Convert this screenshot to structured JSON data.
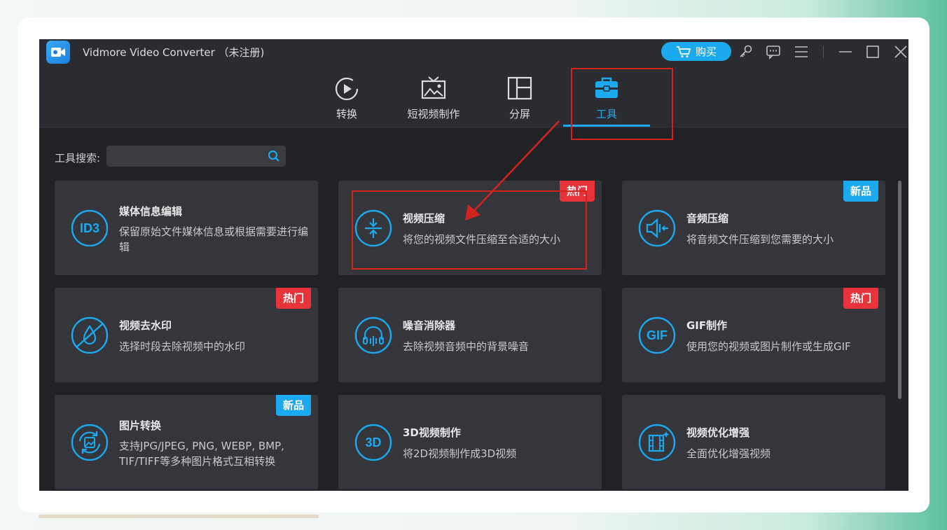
{
  "app": {
    "title": "Vidmore Video Converter （未注册)",
    "buy_label": "购买"
  },
  "titlebar_icons": [
    "key-icon",
    "feedback-icon",
    "menu-icon",
    "minimize-icon",
    "maximize-icon",
    "close-icon"
  ],
  "nav": {
    "tabs": [
      {
        "label": "转换",
        "icon": "convert-icon"
      },
      {
        "label": "短视频制作",
        "icon": "mv-icon"
      },
      {
        "label": "分屏",
        "icon": "collage-icon"
      },
      {
        "label": "工具",
        "icon": "toolbox-icon",
        "active": true
      }
    ]
  },
  "search": {
    "label": "工具搜索:",
    "value": ""
  },
  "tools": [
    {
      "title": "媒体信息编辑",
      "desc": "保留原始文件媒体信息或根据需要进行编辑",
      "icon": "id3-icon",
      "badge": ""
    },
    {
      "title": "视频压缩",
      "desc": "将您的视频文件压缩至合适的大小",
      "icon": "compress-icon",
      "badge": "热门"
    },
    {
      "title": "音频压缩",
      "desc": "将音频文件压缩到您需要的大小",
      "icon": "audio-compress-icon",
      "badge": "新品"
    },
    {
      "title": "视频去水印",
      "desc": "选择时段去除视频中的水印",
      "icon": "watermark-remove-icon",
      "badge": "热门"
    },
    {
      "title": "噪音消除器",
      "desc": "去除视频音频中的背景噪音",
      "icon": "noise-remove-icon",
      "badge": ""
    },
    {
      "title": "GIF制作",
      "desc": "使用您的视频或图片制作或生成GIF",
      "icon": "gif-icon",
      "badge": "热门"
    },
    {
      "title": "图片转换",
      "desc": "支持JPG/JPEG, PNG, WEBP, BMP, TIF/TIFF等多种图片格式互相转换",
      "icon": "image-convert-icon",
      "badge": "新品"
    },
    {
      "title": "3D视频制作",
      "desc": "将2D视频制作成3D视频",
      "icon": "3d-icon",
      "badge": ""
    },
    {
      "title": "视频优化增强",
      "desc": "全面优化增强视频",
      "icon": "enhance-icon",
      "badge": ""
    }
  ],
  "colors": {
    "accent": "#1ba9ef",
    "hot": "#e8333a",
    "annotation": "#d3231f",
    "app_bg": "#2b2c31",
    "card_bg": "#35363c"
  }
}
